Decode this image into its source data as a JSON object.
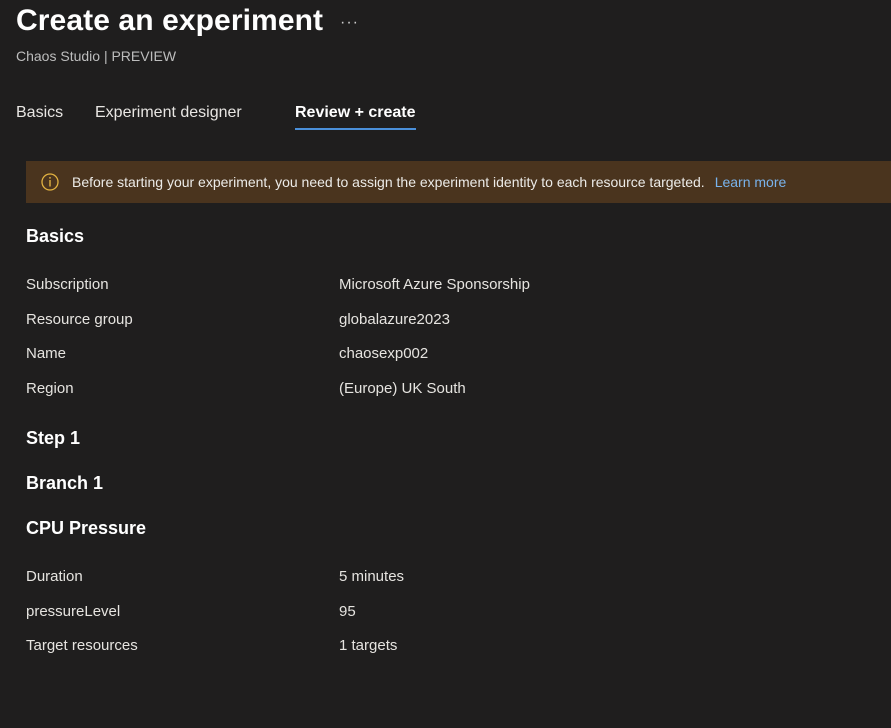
{
  "header": {
    "title": "Create an experiment",
    "more_label": "···",
    "subtitle": "Chaos Studio | PREVIEW"
  },
  "tabs": [
    {
      "label": "Basics",
      "active": false
    },
    {
      "label": "Experiment designer",
      "active": false
    },
    {
      "label": "Review + create",
      "active": true
    }
  ],
  "banner": {
    "icon": "info-icon",
    "message": "Before starting your experiment, you need to assign the experiment identity to each resource targeted.",
    "link": "Learn more"
  },
  "basics": {
    "title": "Basics",
    "rows": [
      {
        "key": "Subscription",
        "value": "Microsoft Azure Sponsorship"
      },
      {
        "key": "Resource group",
        "value": "globalazure2023"
      },
      {
        "key": "Name",
        "value": "chaosexp002"
      },
      {
        "key": "Region",
        "value": "(Europe) UK South"
      }
    ]
  },
  "step": {
    "title": "Step 1"
  },
  "branch": {
    "title": "Branch 1"
  },
  "fault": {
    "title": "CPU Pressure",
    "rows": [
      {
        "key": "Duration",
        "value": "5 minutes"
      },
      {
        "key": "pressureLevel",
        "value": "95"
      },
      {
        "key": "Target resources",
        "value": "1 targets"
      }
    ]
  },
  "colors": {
    "background": "#1f1e1e",
    "banner_bg": "#4a341e",
    "banner_icon": "#e3b341",
    "accent": "#4a8fd9",
    "link": "#79b3ec"
  }
}
